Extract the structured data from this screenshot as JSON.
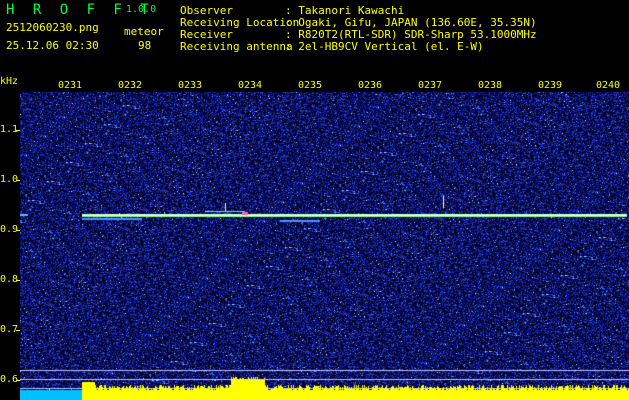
{
  "header": {
    "app_title": "H R O F F T",
    "version": "1.0.0",
    "filename": "2512060230.png",
    "datetime": "25.12.06 02:30",
    "meteor_label": "meteor",
    "meteor_count": "98",
    "fields": [
      {
        "key": "Observer",
        "value": ": Takanori Kawachi"
      },
      {
        "key": "Receiving Location",
        "value": ": Ogaki, Gifu, JAPAN (136.60E, 35.35N)"
      },
      {
        "key": "Receiver",
        "value": ": R820T2(RTL-SDR) SDR-Sharp 53.1000MHz"
      },
      {
        "key": "Receiving antenna",
        "value": ": 2el-HB9CV Vertical (el. E-W)"
      }
    ]
  },
  "axis": {
    "unit": "kHz",
    "time_ticks": [
      "0231",
      "0232",
      "0233",
      "0234",
      "0235",
      "0236",
      "0237",
      "0238",
      "0239",
      "0240"
    ],
    "freq_ticks": [
      "1.1",
      "1.0",
      "0.9",
      "0.8",
      "0.7",
      "0.6"
    ]
  },
  "colors": {
    "label_yellow": "#ffff00",
    "title_green": "#00ff40",
    "noise_blue": "#1a2a90",
    "carrier": "#e0ffe0",
    "bottom_bar": "#ffff00",
    "bottom_bar_cyan": "#00c0ff"
  }
}
